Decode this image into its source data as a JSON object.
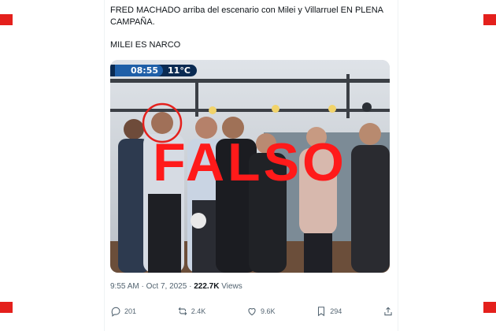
{
  "tweet": {
    "text_line1": "FRED MACHADO arriba del escenario con Milei y Villarruel EN PLENA CAMPAÑA.",
    "text_line2": "MILEI ES NARCO"
  },
  "media": {
    "overlay_time": "08:55",
    "overlay_temp": "11°C",
    "stamp": "FALSO",
    "stamp_color": "#ff1a1a",
    "highlight_color": "#e4201c"
  },
  "meta": {
    "time": "9:55 AM",
    "separator": "·",
    "date": "Oct 7, 2025",
    "views_count": "222.7K",
    "views_label": "Views"
  },
  "actions": {
    "replies": "201",
    "reposts": "2.4K",
    "likes": "9.6K",
    "bookmarks": "294"
  },
  "colors": {
    "corner_marker": "#e4201c",
    "text_primary": "#0f1419",
    "text_secondary": "#536471"
  }
}
